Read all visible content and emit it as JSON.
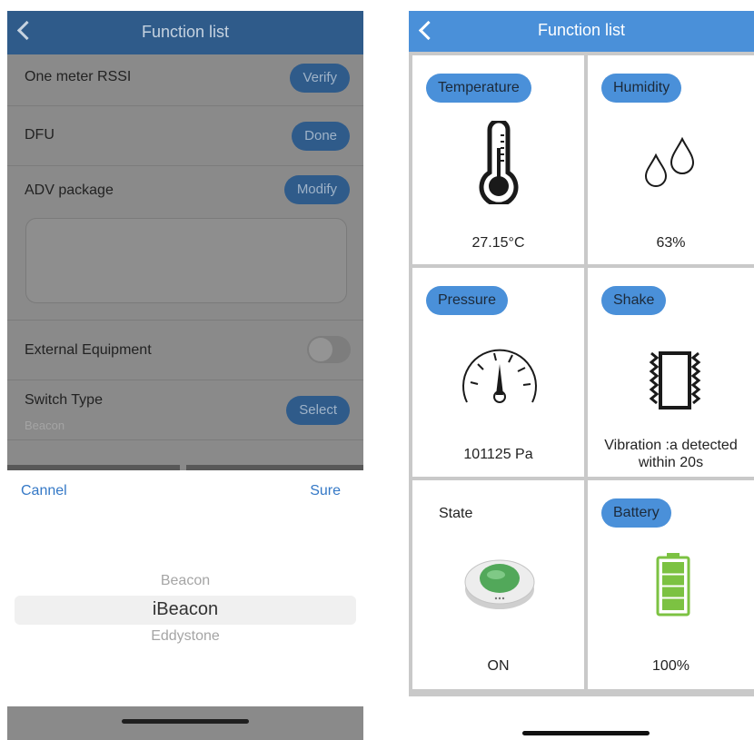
{
  "left": {
    "header": {
      "title": "Function list"
    },
    "rows": [
      {
        "label": "One meter RSSI",
        "button": "Verify"
      },
      {
        "label": "DFU",
        "button": "Done"
      },
      {
        "label": "ADV package",
        "button": "Modify"
      },
      {
        "label": "External Equipment",
        "toggle_on": false
      },
      {
        "label": "Switch Type",
        "value": "Beacon",
        "button": "Select"
      }
    ],
    "picker": {
      "cancel_label": "Cannel",
      "confirm_label": "Sure",
      "options": [
        "Beacon",
        "iBeacon",
        "Eddystone"
      ],
      "selected": "iBeacon"
    }
  },
  "right": {
    "header": {
      "title": "Function list"
    },
    "cells": [
      {
        "label": "Temperature",
        "value": "27.15°C",
        "icon": "thermometer-icon"
      },
      {
        "label": "Humidity",
        "value": "63%",
        "icon": "water-drops-icon"
      },
      {
        "label": "Pressure",
        "value": "101125 Pa",
        "icon": "gauge-icon"
      },
      {
        "label": "Shake",
        "value": "Vibration :a  detected within 20s",
        "icon": "vibration-icon"
      },
      {
        "label": "State",
        "value": "ON",
        "icon": "device-button-icon"
      },
      {
        "label": "Battery",
        "value": "100%",
        "icon": "battery-full-icon",
        "level": 1.0
      }
    ]
  },
  "colors": {
    "left_nav": "#2f5b8a",
    "right_nav": "#4a90d9",
    "badge": "#4a90d9",
    "battery_green": "#7cc242",
    "state_button_green": "#52a85a"
  }
}
